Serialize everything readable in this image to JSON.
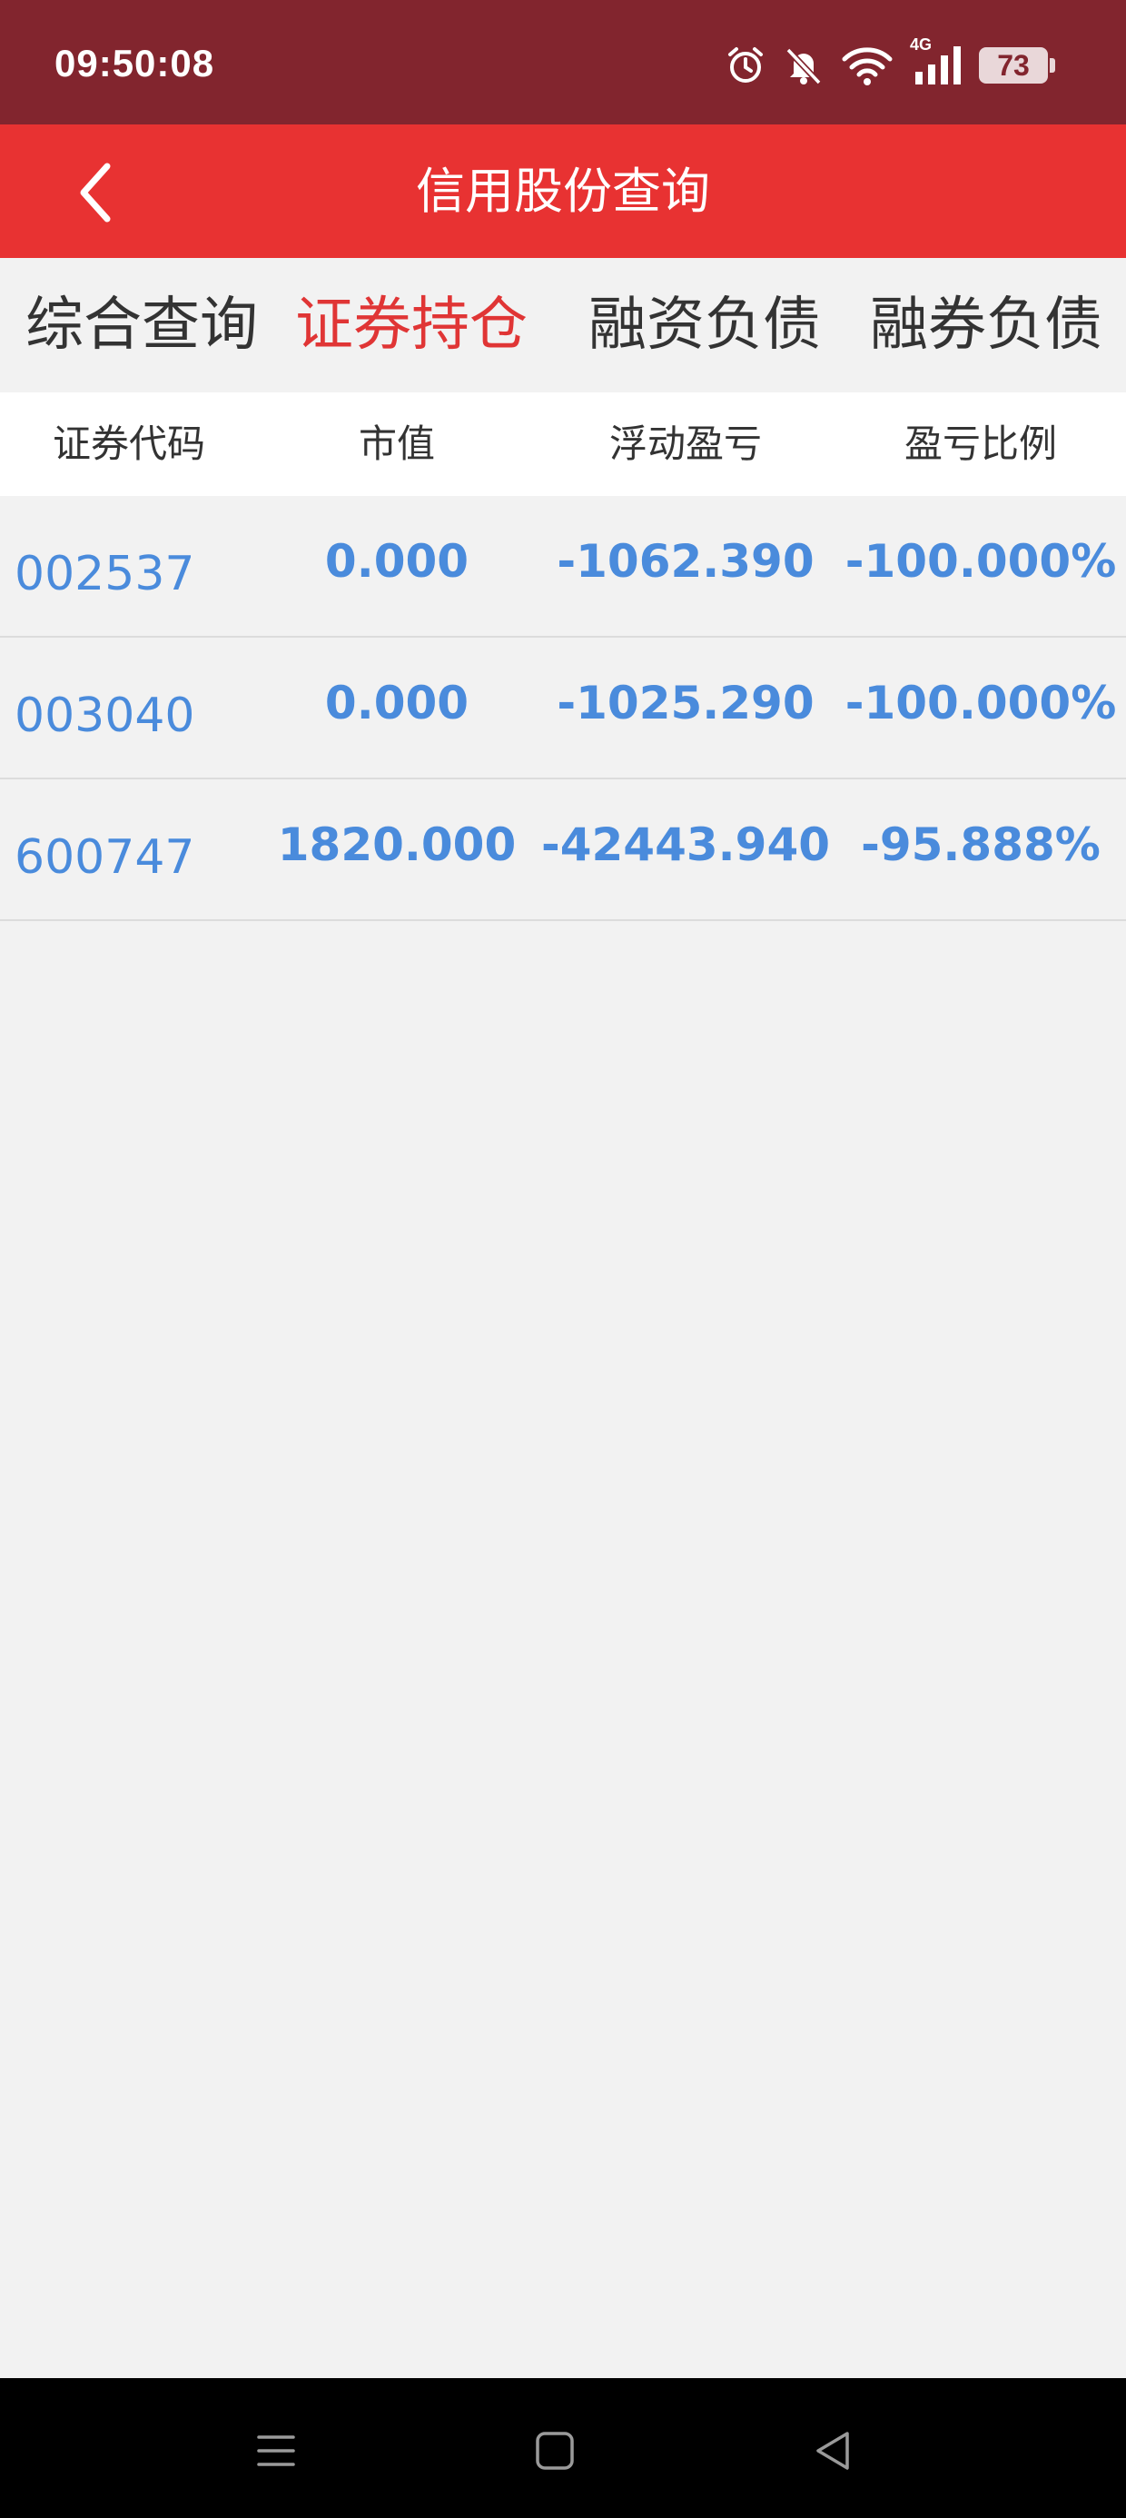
{
  "status_bar": {
    "time": "09:50:08",
    "network": "4G",
    "battery": "73",
    "icons": [
      "alarm-icon",
      "mute-bell-icon",
      "wifi-icon",
      "signal-icon",
      "battery-icon"
    ]
  },
  "header": {
    "title": "信用股份查询",
    "back_icon": "chevron-left-icon",
    "background": "#e83232"
  },
  "tabs": [
    {
      "label": "综合查询",
      "active": false
    },
    {
      "label": "证券持仓",
      "active": true
    },
    {
      "label": "融资负债",
      "active": false
    },
    {
      "label": "融券负债",
      "active": false
    }
  ],
  "table": {
    "columns": [
      "证券代码",
      "市值",
      "浮动盈亏",
      "盈亏比例"
    ],
    "rows": [
      {
        "code": "002537",
        "market_value": "0.000",
        "float_pnl": "-1062.390",
        "pnl_ratio": "-100.000%"
      },
      {
        "code": "003040",
        "market_value": "0.000",
        "float_pnl": "-1025.290",
        "pnl_ratio": "-100.000%"
      },
      {
        "code": "600747",
        "market_value": "1820.000",
        "float_pnl": "-42443.940",
        "pnl_ratio": "-95.888%"
      }
    ],
    "value_color": "#4a8bdc"
  },
  "nav_bar": {
    "icons": [
      "menu-icon",
      "home-icon",
      "back-triangle-icon"
    ]
  },
  "colors": {
    "status_bar": "#82252e",
    "accent": "#e83232",
    "active_tab": "#e03535"
  }
}
